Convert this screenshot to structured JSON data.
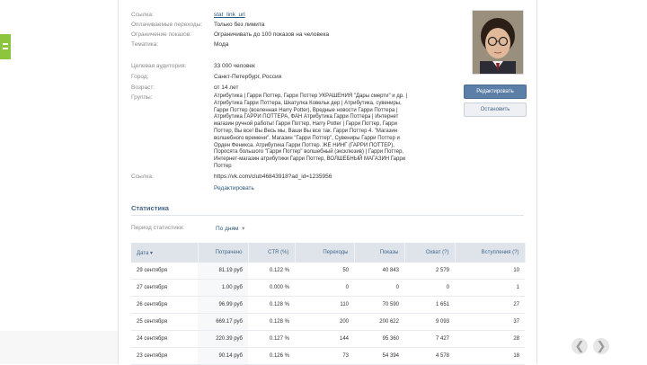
{
  "profile": {
    "fields": [
      {
        "label": "Ссылка:",
        "value": "stat_link_url",
        "link": true
      },
      {
        "label": "Оплачиваемые переходы:",
        "value": "Только без лимита",
        "link": false
      },
      {
        "label": "Ограничение показов:",
        "value": "Ограничивать до 100 показов на человека",
        "link": false
      },
      {
        "label": "Тематика:",
        "value": "Мода",
        "link": false
      },
      {
        "label": "Целевая аудитория:",
        "value": "33 000 человек",
        "link": false
      },
      {
        "label": "Город:",
        "value": "Санкт-Петербург, Россия",
        "link": false
      },
      {
        "label": "Возраст:",
        "value": "от 14 лет",
        "link": false
      }
    ],
    "groups_label": "Группы:",
    "groups_text": "Атрибутика | Гарри Поттер, Гарри Поттер УКРАШЕНИЯ \"Дары смерти\" и др. | Атрибутика Гарри Поттера, Шкатулка Ковельк дер | Атрибутика, сувениры, Гарри Поттер (вселенная Harry Potter), Вредные новости Гарри Поттера | Атрибутика ГАРРИ ПОТТЕРА, ФАН Атрибутика Гарри Поттера | Интернет магазин ручной работы! Гарри Поттер, Harry Potter | Гарри Поттер, Гарри Поттер, Вы все! Вы Весь мы, Ваши Вы все так. Гарри Поттер 4. \"Магазин волшебного времени\". Магазин \"Гарри Поттер\", Сувениры Гарри Поттер и Орден Феникса. Атрибутика Гарри Поттер. ЖЕ НИНГ (ГАРРИ ПОТТЕР), Поросята большого \"Гарри Поттер\" волшебный (эксклюзив) | Гарри Поттер, Интернет-магазин атрибутики Гарри Поттер, ВОЛШЕБНЫЙ МАГАЗИН Гарри Поттер",
    "source_label": "Ссылка:",
    "source_value": "https://vk.com/club46843918?ad_id=1235956",
    "edit_label": "Редактировать"
  },
  "sidebar": {
    "primary_button": "Редактировать",
    "secondary_button": "Остановить"
  },
  "stats": {
    "title": "Статистика",
    "period_label": "Период статистики:",
    "period_value": "По дням",
    "columns": [
      "Дата",
      "Потрачено",
      "CTR (%)",
      "Переходы",
      "Показы",
      "Охват (?)",
      "Вступления (?)"
    ],
    "rows": [
      [
        "29 сентября",
        "81.19 руб",
        "0.122 %",
        "50",
        "40 843",
        "2 579",
        "10"
      ],
      [
        "27 сентября",
        "1.00 руб",
        "0.000 %",
        "0",
        "0",
        "0",
        "1"
      ],
      [
        "26 сентября",
        "96.99 руб",
        "0.128 %",
        "110",
        "70 590",
        "1 651",
        "27"
      ],
      [
        "25 сентября",
        "669.17 руб",
        "0.128 %",
        "200",
        "200 622",
        "9 093",
        "37"
      ],
      [
        "24 сентября",
        "220.39 руб",
        "0.127 %",
        "144",
        "95 360",
        "7 427",
        "28"
      ],
      [
        "23 сентября",
        "90.14 руб",
        "0.126 %",
        "73",
        "54 394",
        "4 578",
        "18"
      ]
    ]
  },
  "nav": {
    "prev": "❮",
    "next": "❯"
  }
}
